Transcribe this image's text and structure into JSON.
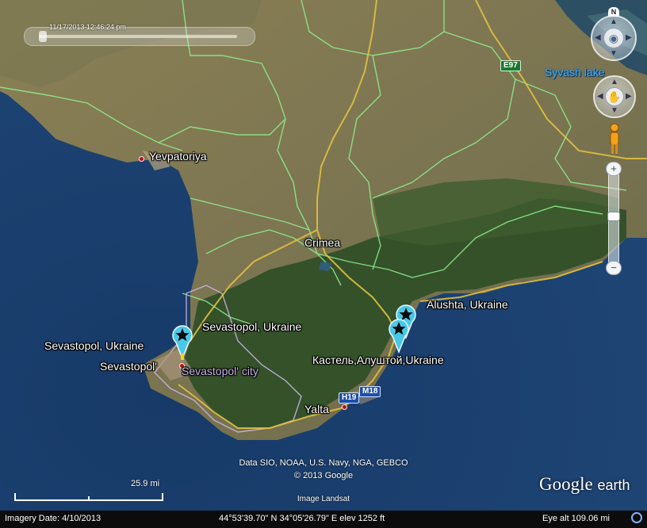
{
  "time_slider": {
    "timestamp": "11/17/2013  12:46:24 pm"
  },
  "labels": {
    "syvash_lake": "Syvash lake",
    "yevpatoriya": "Yevpatoriya",
    "crimea": "Crimea",
    "sevastopol_ukraine_left": "Sevastopol, Ukraine",
    "sevastopol_ukraine_center": "Sevastopol, Ukraine",
    "sevastopol": "Sevastopol'",
    "sevastopol_city": "Sevastopol' city",
    "alushta": "Alushta, Ukraine",
    "kastel": "Кастель,Алуштой,Ukraine",
    "yalta": "Yalta"
  },
  "road_shields": {
    "e97": "E97",
    "h19": "H19",
    "m18": "M18"
  },
  "nav": {
    "north": "N",
    "zoom_in": "+",
    "zoom_out": "−"
  },
  "attribution": {
    "line1": "Data SIO, NOAA, U.S. Navy, NGA, GEBCO",
    "line2": "© 2013 Google",
    "image_provider": "Image Landsat"
  },
  "scale": {
    "label": "25.9 mi"
  },
  "brand": {
    "name": "Google",
    "product": "earth"
  },
  "status_bar": {
    "imagery_date": "Imagery Date: 4/10/2013",
    "coordinates": "44°53'39.70\" N   34°05'26.79\" E  elev  1252 ft",
    "eye_alt": "Eye alt   109.06 mi"
  },
  "colors": {
    "sea": "#1b3f6e",
    "land": "#7d7650",
    "forest": "#2f4a22",
    "borders": "#8ff08f",
    "roads": "#e0c040",
    "pin": "#49c8e8"
  },
  "icons": [
    "look-joystick-icon",
    "move-joystick-icon",
    "street-view-pegman-icon",
    "star-pin-icon",
    "globe-icon"
  ]
}
